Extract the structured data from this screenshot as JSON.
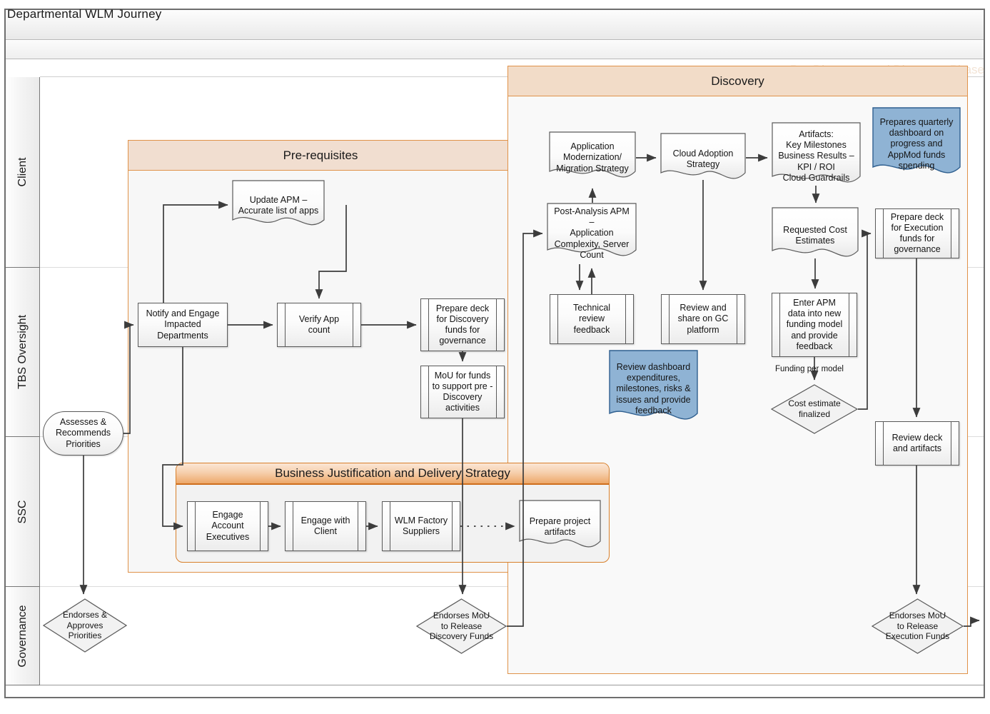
{
  "window": {
    "title": "Departmental WLM Journey"
  },
  "phase_band": {
    "label": "Pre-Discovery and Discovery Phase"
  },
  "lanes": [
    {
      "id": "client",
      "label": "Client"
    },
    {
      "id": "tbs",
      "label": "TBS Oversight"
    },
    {
      "id": "ssc",
      "label": "SSC"
    },
    {
      "id": "governance",
      "label": "Governance"
    }
  ],
  "groups": {
    "prerequisites": {
      "title": "Pre-requisites"
    },
    "discovery": {
      "title": "Discovery"
    },
    "business_justification": {
      "title": "Business Justification and Delivery  Strategy"
    }
  },
  "colors": {
    "group_border_orange": "#e09249",
    "prereq_header_fill": "#f1ded0",
    "discovery_header_fill": "#f2dcc8",
    "bjds_header_fill": "#eda86a",
    "bjds_border": "#d87f2a",
    "blue_note_fill": "#8fb3d4",
    "blue_note_border": "#2f5f8f",
    "shape_border": "#5a5a5a",
    "connector": "#3c3c3c",
    "lane_border": "#777777",
    "watermark_text": "#f3e4d6"
  },
  "nodes": {
    "update_apm": {
      "label": "Update APM –\nAccurate list of apps",
      "shape": "document",
      "lane": "client"
    },
    "notify_engage": {
      "label": "Notify and Engage\nImpacted\nDepartments",
      "shape": "process",
      "lane": "tbs"
    },
    "verify_app_count": {
      "label": "Verify App\ncount",
      "shape": "subprocess",
      "lane": "tbs"
    },
    "prepare_deck_discovery": {
      "label": "Prepare deck\nfor Discovery\nfunds for\ngovernance",
      "shape": "subprocess",
      "lane": "tbs"
    },
    "mou_pre_discovery": {
      "label": "MoU for funds\nto support pre -\nDiscovery\nactivities",
      "shape": "subprocess",
      "lane": "tbs"
    },
    "assesses_recommends": {
      "label": "Assesses &\nRecommends\nPriorities",
      "shape": "terminator",
      "lane": "tbs"
    },
    "endorses_approves_priorities": {
      "label": "Endorses &\nApproves\nPriorities",
      "shape": "decision",
      "lane": "governance"
    },
    "engage_account_executives": {
      "label": "Engage\nAccount\nExecutives",
      "shape": "subprocess",
      "lane": "ssc"
    },
    "engage_with_client": {
      "label": "Engage with\nClient",
      "shape": "subprocess",
      "lane": "ssc"
    },
    "wlm_factory_suppliers": {
      "label": "WLM Factory\nSuppliers",
      "shape": "subprocess",
      "lane": "ssc"
    },
    "prepare_project_artifacts": {
      "label": "Prepare project\nartifacts",
      "shape": "document",
      "lane": "ssc"
    },
    "endorses_mou_discovery": {
      "label": "Endorses MoU\nto Release\nDiscovery Funds",
      "shape": "decision",
      "lane": "governance"
    },
    "app_modernization_strategy": {
      "label": "Application\nModernization/\nMigration Strategy",
      "shape": "document",
      "lane": "client"
    },
    "post_analysis_apm": {
      "label": "Post-Analysis APM –\nApplication\nComplexity, Server\nCount",
      "shape": "document",
      "lane": "client"
    },
    "cloud_adoption_strategy": {
      "label": "Cloud Adoption\nStrategy",
      "shape": "document",
      "lane": "client"
    },
    "artifacts_kpi": {
      "label": "Artifacts:\nKey Milestones\nBusiness Results –\nKPI / ROI\nCloud Guardrails",
      "shape": "document",
      "lane": "client"
    },
    "prepares_quarterly_dashboard": {
      "label": "Prepares quarterly\ndashboard on\nprogress and\nAppMod funds\nspending",
      "shape": "document-blue",
      "lane": "client"
    },
    "requested_cost_estimates": {
      "label": "Requested Cost\nEstimates",
      "shape": "document",
      "lane": "client"
    },
    "prepare_deck_execution": {
      "label": "Prepare deck\nfor Execution\nfunds for\ngovernance",
      "shape": "subprocess",
      "lane": "client"
    },
    "technical_review_feedback": {
      "label": "Technical\nreview\nfeedback",
      "shape": "subprocess",
      "lane": "tbs"
    },
    "review_share_gc": {
      "label": "Review and\nshare on GC\nplatform",
      "shape": "subprocess",
      "lane": "tbs"
    },
    "enter_apm_data": {
      "label": "Enter APM\ndata into new\nfunding model\nand provide\nfeedback",
      "shape": "subprocess",
      "lane": "tbs"
    },
    "review_dashboard_expenditures": {
      "label": "Review dashboard\nexpenditures,\nmilestones, risks &\nissues and provide\nfeedback",
      "shape": "document-blue",
      "lane": "tbs"
    },
    "cost_estimate_finalized": {
      "label": "Cost estimate\nfinalized",
      "shape": "decision",
      "lane": "tbs"
    },
    "review_deck_artifacts": {
      "label": "Review deck\nand artifacts",
      "shape": "subprocess",
      "lane": "ssc"
    },
    "endorses_mou_execution": {
      "label": "Endorses MoU\nto Release\nExecution Funds",
      "shape": "decision",
      "lane": "governance"
    }
  },
  "edge_labels": {
    "funding_per_model": "Funding per model"
  }
}
